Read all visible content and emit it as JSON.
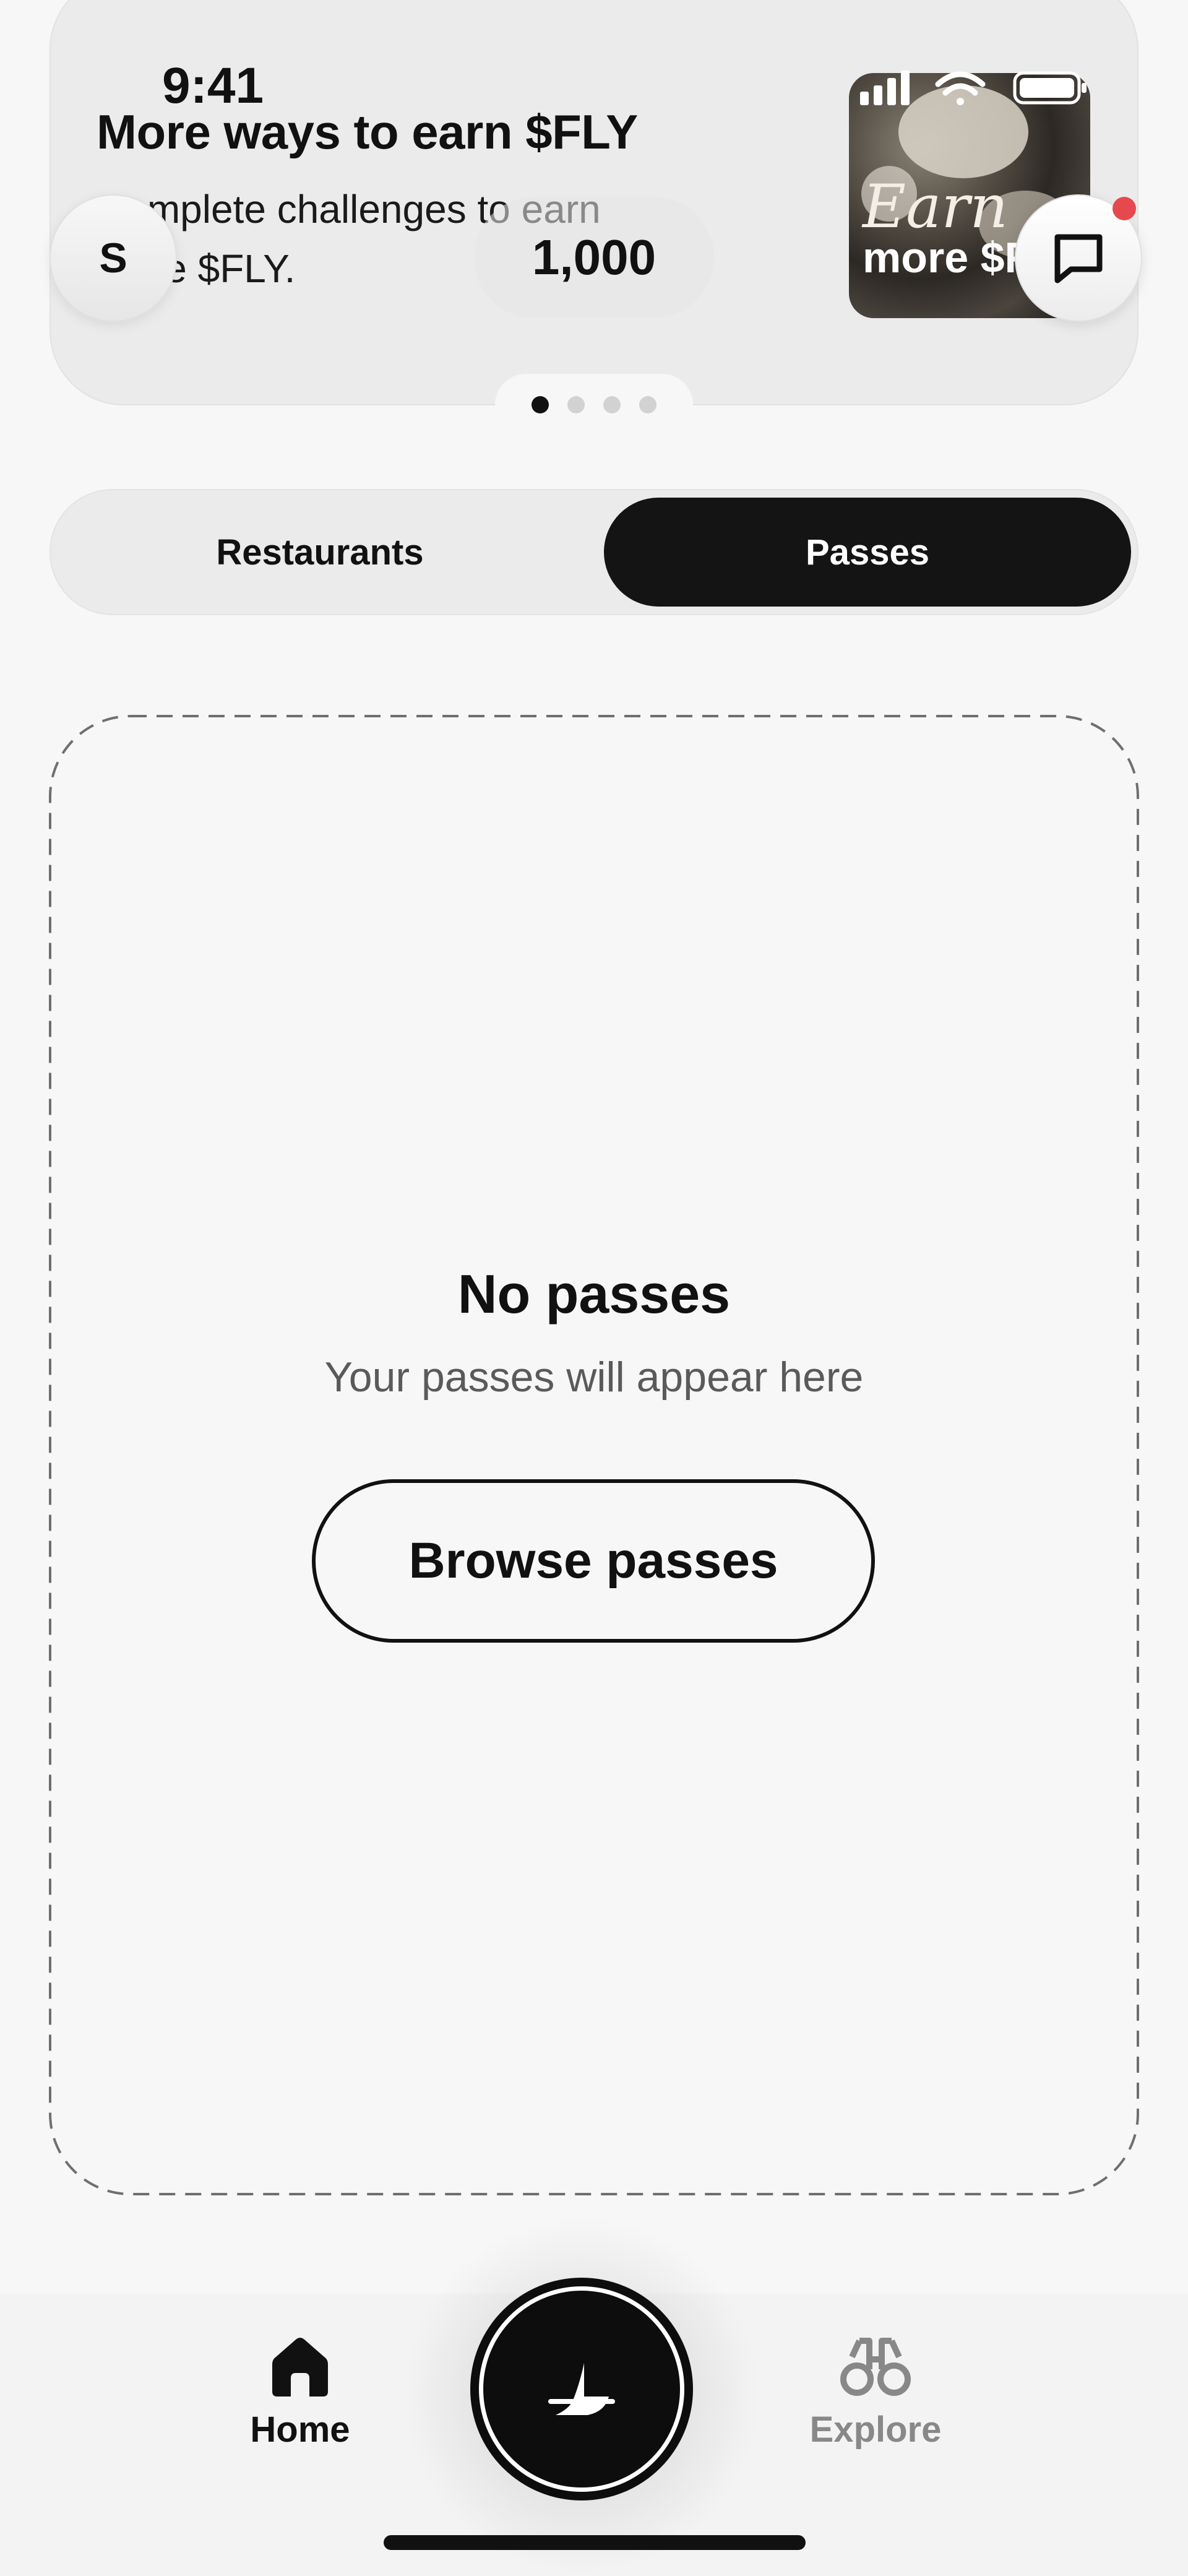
{
  "status_bar": {
    "time": "9:41"
  },
  "header": {
    "avatar_initial": "S",
    "balance": "1,000"
  },
  "promo": {
    "title": "More ways to earn $FLY",
    "subtitle": "Complete challenges to earn more $FLY.",
    "image_caption_italic": "Earn",
    "image_caption_bold": "more $FLY",
    "pages": 4,
    "active_page": 1
  },
  "tabs": [
    {
      "label": "Restaurants",
      "selected": false
    },
    {
      "label": "Passes",
      "selected": true
    }
  ],
  "empty_state": {
    "title": "No passes",
    "subtitle": "Your passes will appear here",
    "button_label": "Browse passes"
  },
  "bottom_nav": {
    "home_label": "Home",
    "explore_label": "Explore"
  },
  "colors": {
    "accent": "#111111",
    "notification_dot": "#e5484d",
    "inactive_label": "#888888"
  }
}
